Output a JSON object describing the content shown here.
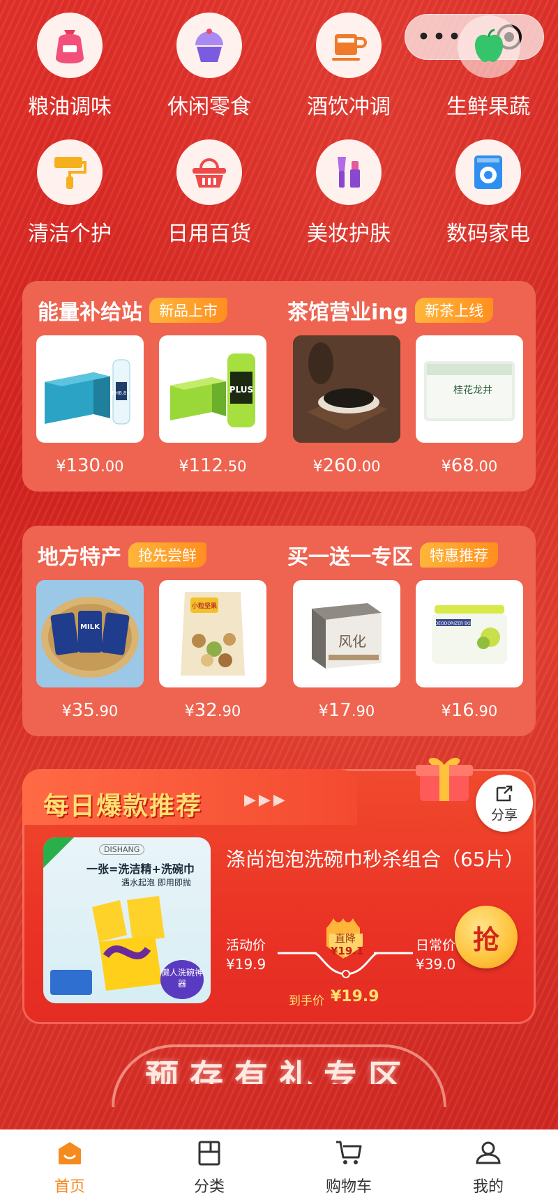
{
  "capsule": {
    "more_icon": "more-dots-icon",
    "close_icon": "target-close-icon"
  },
  "categories": [
    {
      "label": "粮油调味",
      "icon": "grain-sack-icon"
    },
    {
      "label": "休闲零食",
      "icon": "cupcake-icon"
    },
    {
      "label": "酒饮冲调",
      "icon": "cup-icon"
    },
    {
      "label": "生鲜果蔬",
      "icon": "apple-icon"
    },
    {
      "label": "清洁个护",
      "icon": "paint-roller-icon"
    },
    {
      "label": "日用百货",
      "icon": "basket-icon"
    },
    {
      "label": "美妆护肤",
      "icon": "makeup-icon"
    },
    {
      "label": "数码家电",
      "icon": "washing-machine-icon"
    }
  ],
  "panel1": {
    "left": {
      "title": "能量补给站",
      "tag": "新品上市",
      "products": [
        {
          "cur": "¥",
          "int": "130",
          "dec": ".00"
        },
        {
          "cur": "¥",
          "int": "112",
          "dec": ".50"
        }
      ]
    },
    "right": {
      "title": "茶馆营业ing",
      "tag": "新茶上线",
      "products": [
        {
          "cur": "¥",
          "int": "260",
          "dec": ".00"
        },
        {
          "cur": "¥",
          "int": "68",
          "dec": ".00"
        }
      ]
    }
  },
  "panel2": {
    "left": {
      "title": "地方特产",
      "tag": "抢先尝鲜",
      "products": [
        {
          "cur": "¥",
          "int": "35",
          "dec": ".90"
        },
        {
          "cur": "¥",
          "int": "32",
          "dec": ".90"
        }
      ]
    },
    "right": {
      "title": "买一送一专区",
      "tag": "特惠推荐",
      "products": [
        {
          "cur": "¥",
          "int": "17",
          "dec": ".90"
        },
        {
          "cur": "¥",
          "int": "16",
          "dec": ".90"
        }
      ]
    }
  },
  "product_labels": {
    "water_box": "PH8.8+",
    "plus_drink": "PLUS",
    "tea_box": "桂花龙井",
    "milk_biscuit": "MILK",
    "nuts_bag": "小粒坚果",
    "cake_box": "风化",
    "deodorizer": "DEODORIZER BOX"
  },
  "deal": {
    "title": "每日爆款推荐",
    "share_label": "分享",
    "product_name": "涤尚泡泡洗碗巾秒杀组合（65片）",
    "img_brand": "DISHANG",
    "img_headline": "一张=洗洁精+洗碗巾",
    "img_sub": "遇水起泡 即用即抛",
    "img_badge": "懒人洗碗神器",
    "activity_label": "活动价",
    "activity_price": "¥19.9",
    "drop_label": "直降",
    "drop_value": "¥19.1",
    "regular_label": "日常价",
    "regular_price": "¥39.0",
    "final_label": "到手价",
    "final_price": "¥19.9",
    "grab_label": "抢"
  },
  "banner": {
    "text": "预存有礼专区"
  },
  "tabbar": [
    {
      "label": "首页",
      "icon": "home-icon",
      "active": true
    },
    {
      "label": "分类",
      "icon": "category-icon",
      "active": false
    },
    {
      "label": "购物车",
      "icon": "cart-icon",
      "active": false
    },
    {
      "label": "我的",
      "icon": "profile-icon",
      "active": false
    }
  ],
  "colors": {
    "brand_red": "#e3302a",
    "accent_orange": "#f58a1f",
    "tag_orange": "#ff9f2a",
    "grab_yellow": "#ffc23a"
  }
}
